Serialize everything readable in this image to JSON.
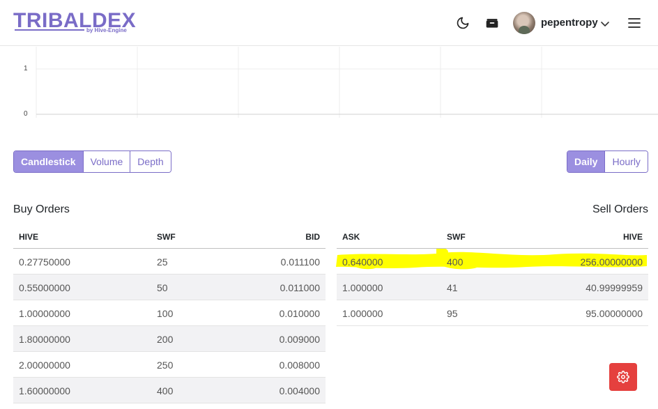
{
  "header": {
    "logo_text": "TRIBALDEX",
    "logo_sub": "by Hive-Engine",
    "username": "pepentropy",
    "icons": [
      "moon-icon",
      "wallet-icon",
      "chevron-down-icon",
      "hamburger-icon"
    ]
  },
  "chart": {
    "y_ticks": [
      "1",
      "0"
    ]
  },
  "chart_tabs": {
    "items": [
      "Candlestick",
      "Volume",
      "Depth"
    ],
    "active": "Candlestick"
  },
  "period_tabs": {
    "items": [
      "Daily",
      "Hourly"
    ],
    "active": "Daily"
  },
  "buy_orders": {
    "title": "Buy Orders",
    "columns": [
      "HIVE",
      "SWF",
      "BID"
    ],
    "rows": [
      [
        "0.27750000",
        "25",
        "0.011100"
      ],
      [
        "0.55000000",
        "50",
        "0.011000"
      ],
      [
        "1.00000000",
        "100",
        "0.010000"
      ],
      [
        "1.80000000",
        "200",
        "0.009000"
      ],
      [
        "2.00000000",
        "250",
        "0.008000"
      ],
      [
        "1.60000000",
        "400",
        "0.004000"
      ]
    ]
  },
  "sell_orders": {
    "title": "Sell Orders",
    "columns": [
      "ASK",
      "SWF",
      "HIVE"
    ],
    "rows": [
      [
        "0.640000",
        "400",
        "256.00000000"
      ],
      [
        "1.000000",
        "41",
        "40.99999959"
      ],
      [
        "1.000000",
        "95",
        "95.00000000"
      ]
    ]
  },
  "colors": {
    "brand": "#7a6cc7",
    "active_tab": "#9b8fe0",
    "highlight": "#ffff00",
    "fab": "#e5403e"
  }
}
